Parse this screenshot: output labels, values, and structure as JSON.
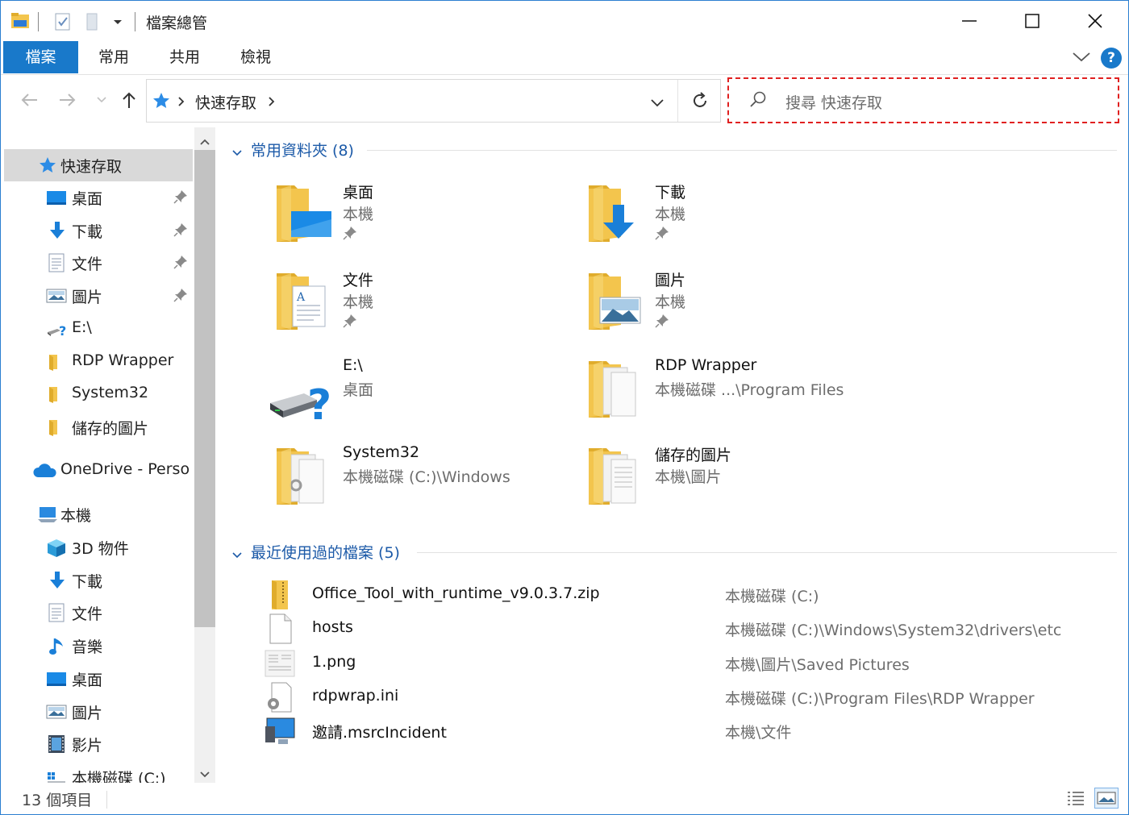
{
  "window": {
    "title": "檔案總管"
  },
  "ribbon": {
    "tabs": [
      {
        "label": "檔案",
        "active": true
      },
      {
        "label": "常用"
      },
      {
        "label": "共用"
      },
      {
        "label": "檢視"
      }
    ],
    "help_label": "?"
  },
  "address": {
    "breadcrumb": [
      "快速存取"
    ],
    "search_placeholder": "搜尋 快速存取"
  },
  "sidebar": {
    "items": [
      {
        "label": "快速存取",
        "icon": "star-icon"
      },
      {
        "label": "桌面",
        "icon": "desktop-icon",
        "pinned": true
      },
      {
        "label": "下載",
        "icon": "download-icon",
        "pinned": true
      },
      {
        "label": "文件",
        "icon": "documents-icon",
        "pinned": true
      },
      {
        "label": "圖片",
        "icon": "pictures-icon",
        "pinned": true
      },
      {
        "label": "E:\\",
        "icon": "unknown-drive-icon"
      },
      {
        "label": "RDP Wrapper",
        "icon": "folder-icon"
      },
      {
        "label": "System32",
        "icon": "folder-icon"
      },
      {
        "label": "儲存的圖片",
        "icon": "folder-icon"
      },
      {
        "label": "OneDrive - Perso",
        "icon": "onedrive-icon"
      },
      {
        "label": "本機",
        "icon": "this-pc-icon"
      },
      {
        "label": "3D 物件",
        "icon": "3d-objects-icon"
      },
      {
        "label": "下載",
        "icon": "download-icon"
      },
      {
        "label": "文件",
        "icon": "documents-icon"
      },
      {
        "label": "音樂",
        "icon": "music-icon"
      },
      {
        "label": "桌面",
        "icon": "desktop-icon"
      },
      {
        "label": "圖片",
        "icon": "pictures-icon"
      },
      {
        "label": "影片",
        "icon": "videos-icon"
      },
      {
        "label": "本機磁碟 (C:)",
        "icon": "drive-c-icon"
      }
    ]
  },
  "frequent": {
    "header": "常用資料夾 (8)",
    "tiles": [
      {
        "name": "桌面",
        "sub": "本機",
        "pinned": true,
        "icon": "desktop-folder-icon"
      },
      {
        "name": "下載",
        "sub": "本機",
        "pinned": true,
        "icon": "download-folder-icon"
      },
      {
        "name": "文件",
        "sub": "本機",
        "pinned": true,
        "icon": "documents-folder-icon"
      },
      {
        "name": "圖片",
        "sub": "本機",
        "pinned": true,
        "icon": "pictures-folder-icon"
      },
      {
        "name": "E:\\",
        "sub": "桌面",
        "pinned": false,
        "icon": "unknown-drive-icon"
      },
      {
        "name": "RDP Wrapper",
        "sub": "本機磁碟 ...\\Program Files",
        "pinned": false,
        "icon": "folder-icon"
      },
      {
        "name": "System32",
        "sub": "本機磁碟 (C:)\\Windows",
        "pinned": false,
        "icon": "folder-icon"
      },
      {
        "name": "儲存的圖片",
        "sub": "本機\\圖片",
        "pinned": false,
        "icon": "folder-icon"
      }
    ]
  },
  "recent": {
    "header": "最近使用過的檔案 (5)",
    "files": [
      {
        "name": "Office_Tool_with_runtime_v9.0.3.7.zip",
        "path": "本機磁碟 (C:)",
        "icon": "zip-folder-icon"
      },
      {
        "name": "hosts",
        "path": "本機磁碟 (C:)\\Windows\\System32\\drivers\\etc",
        "icon": "blank-file-icon"
      },
      {
        "name": "1.png",
        "path": "本機\\圖片\\Saved Pictures",
        "icon": "image-file-icon"
      },
      {
        "name": "rdpwrap.ini",
        "path": "本機磁碟 (C:)\\Program Files\\RDP Wrapper",
        "icon": "settings-file-icon"
      },
      {
        "name": "邀請.msrcIncident",
        "path": "本機\\文件",
        "icon": "remote-assistance-icon"
      }
    ]
  },
  "status": {
    "item_count": "13 個項目"
  },
  "colors": {
    "accent": "#1979ca",
    "group_header": "#1c5aa8",
    "folder": "#f3c54d",
    "search_highlight": "#e02020"
  }
}
